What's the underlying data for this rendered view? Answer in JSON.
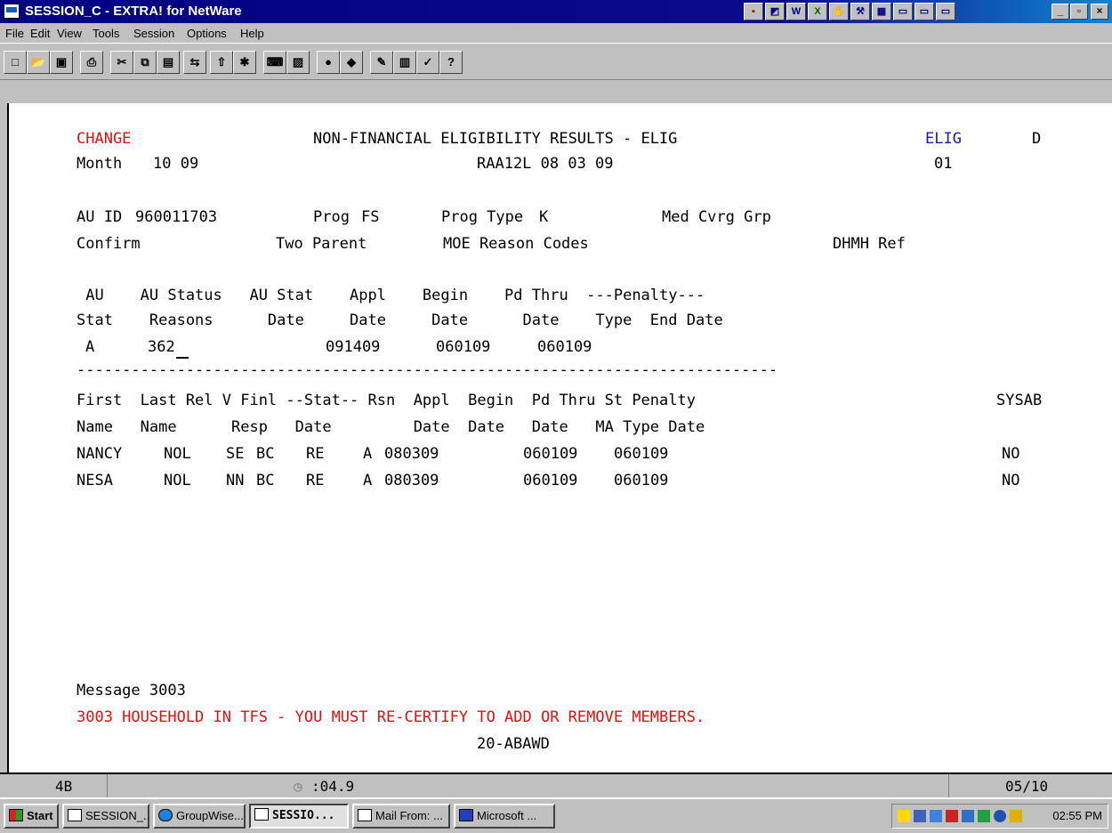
{
  "window": {
    "title": "SESSION_C - EXTRA! for NetWare"
  },
  "menu": [
    "File",
    "Edit",
    "View",
    "Tools",
    "Session",
    "Options",
    "Help"
  ],
  "screen": {
    "header": {
      "mode": "CHANGE",
      "title": "NON-FINANCIAL ELIGIBILITY RESULTS - ELIG",
      "screen_code": "ELIG",
      "flag": "D",
      "month_label": "Month",
      "month_value": "10 09",
      "operator": "RAA12L 08 03 09",
      "page": "01"
    },
    "au_info": {
      "au_id_label": "AU ID",
      "au_id": "960011703",
      "prog_label": "Prog",
      "prog": "FS",
      "prog_type_label": "Prog Type",
      "prog_type": "K",
      "med_cvrg_grp_label": "Med Cvrg Grp",
      "confirm_label": "Confirm",
      "two_parent_label": "Two Parent",
      "moe_label": "MOE Reason Codes",
      "dhmh_label": "DHMH Ref"
    },
    "au_table": {
      "header1": " AU    AU Status   AU Stat    Appl    Begin    Pd Thru  ---Penalty---",
      "header2": "Stat    Reasons      Date     Date     Date      Date    Type  End Date",
      "row": {
        "stat": "A",
        "reasons": "362",
        "stat_date": "091409",
        "appl_date": "060109",
        "begin_date": "060109"
      }
    },
    "divider": "-----------------------------------------------------------------------------",
    "member_table": {
      "header1": "First  Last Rel V Finl --Stat-- Rsn  Appl  Begin  Pd Thru St Penalty",
      "header1_right": "SYSAB",
      "header2": "Name   Name      Resp   Date         Date  Date   Date   MA Type Date",
      "rows": [
        {
          "first": "NANCY",
          "last": "NOL",
          "rel": "SE",
          "v": "BC",
          "resp": "RE",
          "stat": "A",
          "stat_date": "080309",
          "appl": "060109",
          "begin": "060109",
          "sysab": "NO"
        },
        {
          "first": "NESA",
          "last": "NOL",
          "rel": "NN",
          "v": "BC",
          "resp": "RE",
          "stat": "A",
          "stat_date": "080309",
          "appl": "060109",
          "begin": "060109",
          "sysab": "NO"
        }
      ]
    },
    "message_label": "Message 3003",
    "message_text": "3003 HOUSEHOLD IN TFS - YOU MUST RE-CERTIFY TO ADD OR REMOVE MEMBERS.",
    "footer_code": "20-ABAWD"
  },
  "statusline": {
    "indicator": "4B",
    "timer": ":04.9",
    "position": "05/10"
  },
  "taskbar": {
    "start": "Start",
    "buttons": [
      "SESSION_...",
      "GroupWise...",
      "SESSIO...",
      "Mail From: ...",
      "Microsoft ..."
    ],
    "clock": "02:55 PM"
  },
  "colors": {
    "title_bar": "#000080",
    "red_text": "#e01010",
    "blue_text": "#1818b0"
  }
}
